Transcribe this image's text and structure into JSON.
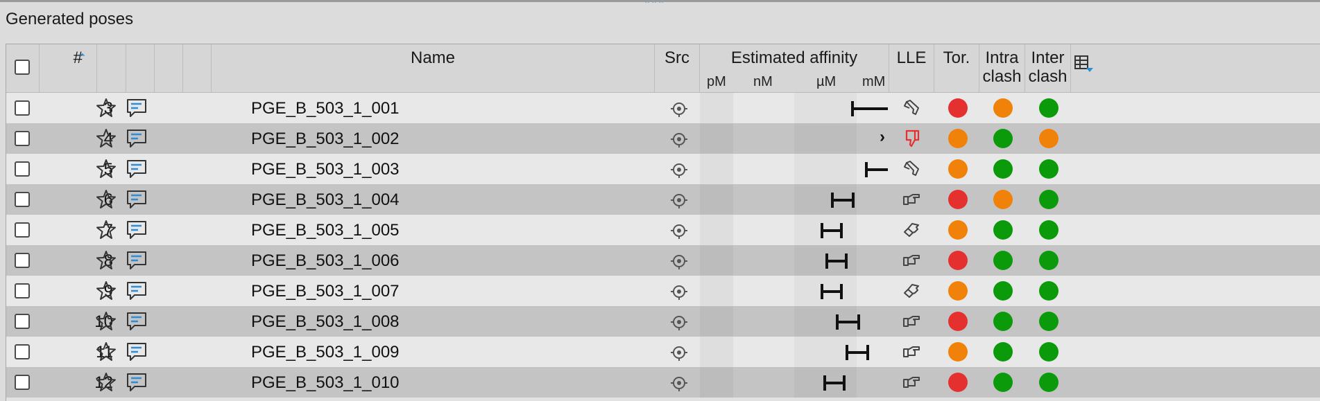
{
  "panel_title": "Generated poses",
  "columns": {
    "num": "#",
    "name": "Name",
    "src": "Src",
    "affinity": "Estimated affinity",
    "affinity_units": [
      "pM",
      "nM",
      "µM",
      "mM"
    ],
    "lle": "LLE",
    "tor": "Tor.",
    "intra_l1": "Intra",
    "intra_l2": "clash",
    "inter_l1": "Inter",
    "inter_l2": "clash"
  },
  "colors": {
    "red": "#e53030",
    "orange": "#f0820a",
    "green": "#0a9a0a",
    "accent": "#2a8fd6"
  },
  "icons": {
    "favorite": "star-icon",
    "comment": "comment-icon",
    "source": "target-icon",
    "lle_down": "thumbs-down-icon"
  },
  "rows": [
    {
      "num": "3",
      "name": "PGE_B_503_1_001",
      "lle": "thumbs-down-outline",
      "affinity_range": [
        "~ 60 µM",
        "> 1 mM"
      ],
      "tor": "red",
      "intra": "orange",
      "inter": "green"
    },
    {
      "num": "4",
      "name": "PGE_B_503_1_002",
      "lle": "thumbs-down-red",
      "affinity_range": [
        "> 1 mM",
        "> 1 mM"
      ],
      "tor": "orange",
      "intra": "green",
      "inter": "orange"
    },
    {
      "num": "5",
      "name": "PGE_B_503_1_003",
      "lle": "thumbs-down-outline",
      "affinity_range": [
        "~ 0.4 mM",
        "> 1 mM"
      ],
      "tor": "orange",
      "intra": "green",
      "inter": "green"
    },
    {
      "num": "6",
      "name": "PGE_B_503_1_004",
      "lle": "thumbs-right",
      "affinity_range": [
        "~ 4 µM",
        "~ 100 µM"
      ],
      "tor": "red",
      "intra": "orange",
      "inter": "green"
    },
    {
      "num": "7",
      "name": "PGE_B_503_1_005",
      "lle": "thumbs-up-outline",
      "affinity_range": [
        "~ 1 µM",
        "~ 20 µM"
      ],
      "tor": "orange",
      "intra": "green",
      "inter": "green"
    },
    {
      "num": "8",
      "name": "PGE_B_503_1_006",
      "lle": "thumbs-right",
      "affinity_range": [
        "~ 2 µM",
        "~ 40 µM"
      ],
      "tor": "red",
      "intra": "green",
      "inter": "green"
    },
    {
      "num": "9",
      "name": "PGE_B_503_1_007",
      "lle": "thumbs-up-outline",
      "affinity_range": [
        "~ 1 µM",
        "~ 20 µM"
      ],
      "tor": "orange",
      "intra": "green",
      "inter": "green"
    },
    {
      "num": "10",
      "name": "PGE_B_503_1_008",
      "lle": "thumbs-right",
      "affinity_range": [
        "~ 8 µM",
        "~ 200 µM"
      ],
      "tor": "red",
      "intra": "green",
      "inter": "green"
    },
    {
      "num": "11",
      "name": "PGE_B_503_1_009",
      "lle": "thumbs-right",
      "affinity_range": [
        "~ 30 µM",
        "~ 0.7 mM"
      ],
      "tor": "orange",
      "intra": "green",
      "inter": "green"
    },
    {
      "num": "12",
      "name": "PGE_B_503_1_010",
      "lle": "thumbs-right",
      "affinity_range": [
        "~ 1.5 µM",
        "~ 30 µM"
      ],
      "tor": "red",
      "intra": "green",
      "inter": "green"
    }
  ]
}
